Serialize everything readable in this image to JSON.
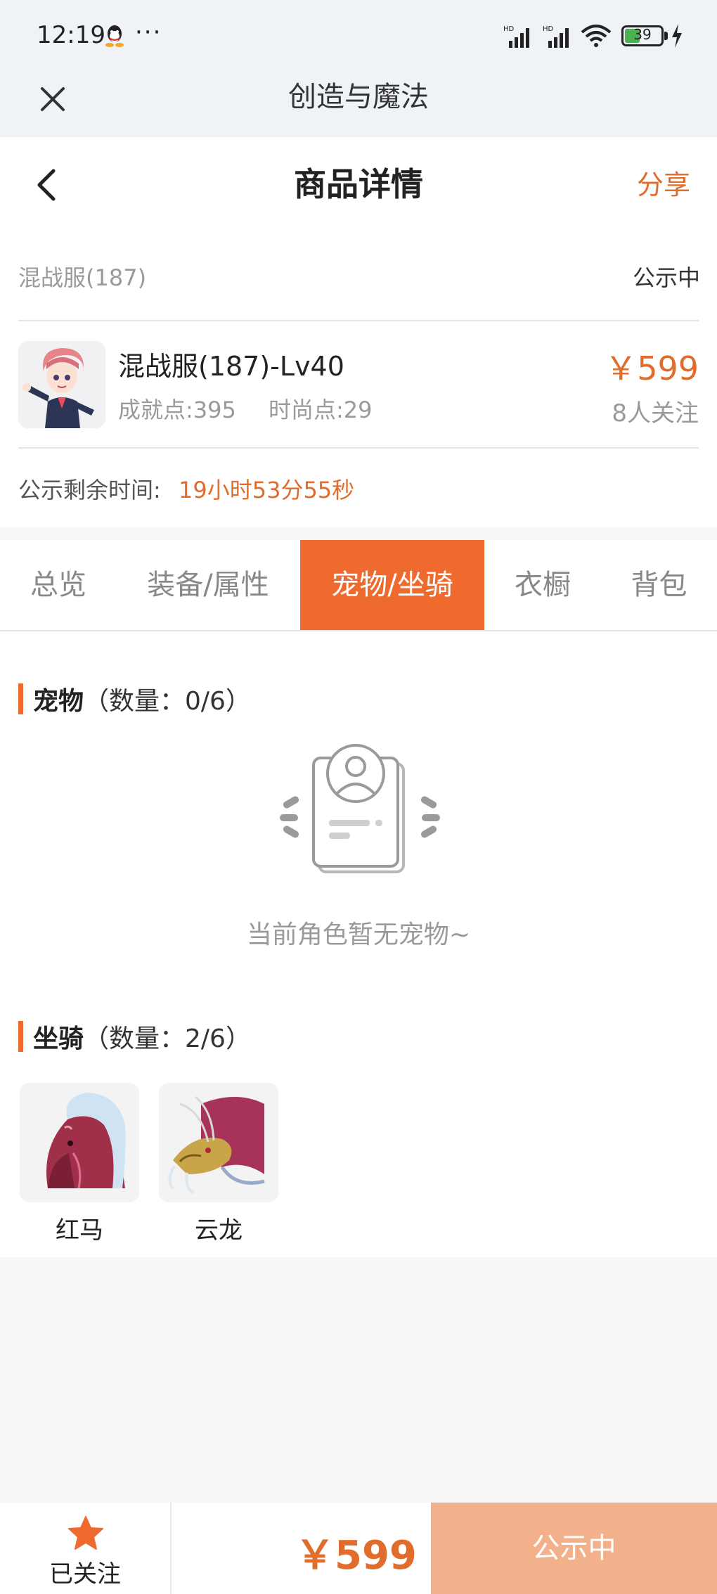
{
  "status_bar": {
    "time": "12:19",
    "dots": "···",
    "battery": "39",
    "icons": [
      "qq-icon",
      "signal-hd-icon",
      "signal-hd-icon",
      "wifi-icon",
      "battery-icon",
      "charging-icon"
    ]
  },
  "app_bar": {
    "title": "创造与魔法",
    "close_icon": "close-icon"
  },
  "header": {
    "title": "商品详情",
    "share_label": "分享",
    "back_icon": "chevron-left-icon"
  },
  "item": {
    "server": "混战服(187)",
    "status": "公示中",
    "name": "混战服(187)-Lv40",
    "achievement": "成就点:395",
    "fashion": "时尚点:29",
    "price": "￥599",
    "followers": "8人关注",
    "remaining_label": "公示剩余时间:",
    "remaining_value": "19小时53分55秒"
  },
  "tabs": [
    {
      "label": "总览",
      "active": false
    },
    {
      "label": "装备/属性",
      "active": false
    },
    {
      "label": "宠物/坐骑",
      "active": true
    },
    {
      "label": "衣橱",
      "active": false
    },
    {
      "label": "背包",
      "active": false
    }
  ],
  "pets": {
    "title": "宠物",
    "count": "（数量：0/6）",
    "empty_text": "当前角色暂无宠物~"
  },
  "mounts": {
    "title": "坐骑",
    "count": "（数量：2/6）",
    "items": [
      {
        "name": "红马"
      },
      {
        "name": "云龙"
      }
    ]
  },
  "footer": {
    "follow_label": "已关注",
    "price": "￥599",
    "action_label": "公示中",
    "star_icon": "star-icon"
  },
  "colors": {
    "accent": "#ef6a2e",
    "price": "#e06d2b",
    "action_bg": "#f2b08b",
    "status_bg": "#eff3f8"
  }
}
